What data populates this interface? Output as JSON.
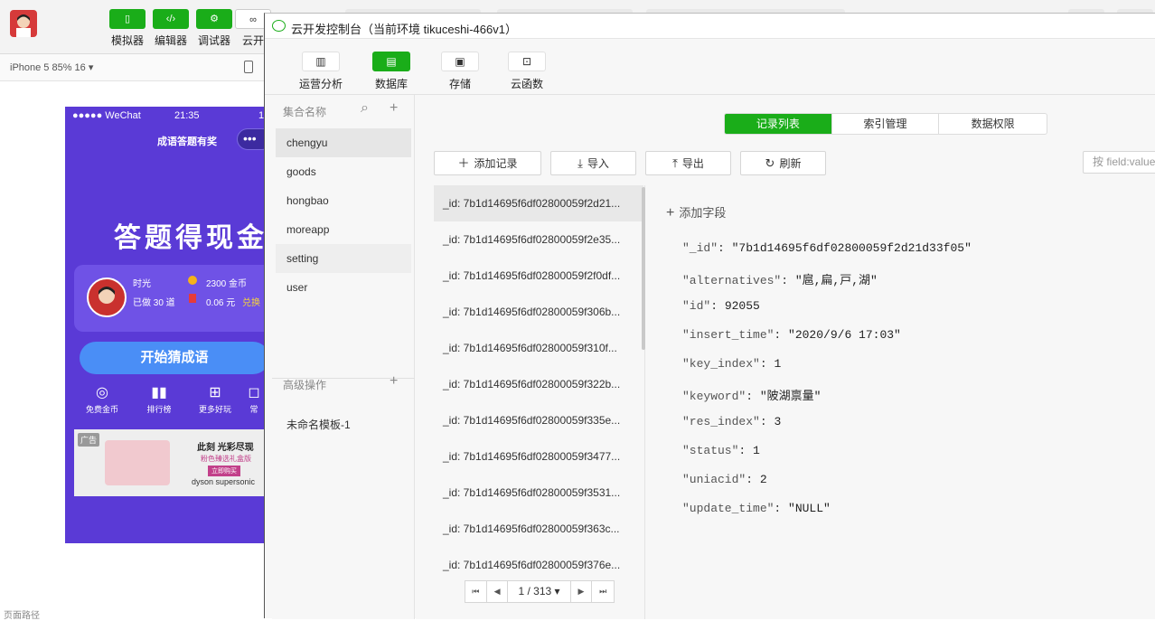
{
  "ide": {
    "tools": [
      {
        "label": "模拟器",
        "icon": "phone-icon",
        "glyph": "▯"
      },
      {
        "label": "编辑器",
        "icon": "code-icon",
        "glyph": "‹/›"
      },
      {
        "label": "调试器",
        "icon": "sliders-icon",
        "glyph": "⚙"
      },
      {
        "label": "云开",
        "icon": "cloud-icon",
        "glyph": "∞"
      }
    ]
  },
  "simulator": {
    "device": "iPhone 5 85% 16 ▾",
    "phone": {
      "carrier": "●●●●● WeChat",
      "time": "21:35",
      "battery": "1",
      "title": "成语答题有奖",
      "capsule": "•••",
      "hero": "答题得现金",
      "user_name": "时光",
      "done": "已做 30 道",
      "coins": "2300 金币",
      "cash": "0.06 元",
      "exchange": "兑换",
      "start_button": "开始猜成语",
      "icons": [
        "免费金币",
        "排行榜",
        "更多好玩",
        "常"
      ],
      "ad": {
        "tag": "广告",
        "line1": "此刻 光彩尽现",
        "line2": "粉色臻选礼盒版",
        "cta": "立即购买",
        "brand": "dyson supersonic"
      }
    },
    "footer": "页面路径"
  },
  "console": {
    "title": "云开发控制台（当前环境 tikuceshi-466v1）",
    "tabs": [
      {
        "label": "运营分析",
        "glyph": "▥",
        "active": false
      },
      {
        "label": "数据库",
        "glyph": "▤",
        "active": true
      },
      {
        "label": "存储",
        "glyph": "▣",
        "active": false
      },
      {
        "label": "云函数",
        "glyph": "⊡",
        "active": false
      }
    ],
    "collections_header": "集合名称",
    "collections": [
      "chengyu",
      "goods",
      "hongbao",
      "moreapp",
      "setting",
      "user"
    ],
    "advanced_header": "高级操作",
    "advanced_items": [
      "未命名模板-1"
    ],
    "segments": [
      "记录列表",
      "索引管理",
      "数据权限"
    ],
    "actions": {
      "add": "添加记录",
      "import": "导入",
      "export": "导出",
      "refresh": "刷新"
    },
    "filter_placeholder": "按 field:value",
    "records": [
      "_id: 7b1d14695f6df02800059f2d21...",
      "_id: 7b1d14695f6df02800059f2e35...",
      "_id: 7b1d14695f6df02800059f2f0df...",
      "_id: 7b1d14695f6df02800059f306b...",
      "_id: 7b1d14695f6df02800059f310f...",
      "_id: 7b1d14695f6df02800059f322b...",
      "_id: 7b1d14695f6df02800059f335e...",
      "_id: 7b1d14695f6df02800059f3477...",
      "_id: 7b1d14695f6df02800059f3531...",
      "_id: 7b1d14695f6df02800059f363c...",
      "_id: 7b1d14695f6df02800059f376e..."
    ],
    "pager": {
      "first": "⏮",
      "prev": "◀",
      "page": "1 / 313 ▾",
      "next": "▶",
      "last": "⏭"
    },
    "add_field": "添加字段",
    "document": [
      {
        "key": "\"_id\"",
        "value": "\"7b1d14695f6df02800059f2d21d33f05\""
      },
      {
        "key": "\"alternatives\"",
        "value": "\"扈,扁,戸,湖\""
      },
      {
        "key": "\"id\"",
        "value": "92055"
      },
      {
        "key": "\"insert_time\"",
        "value": "\"2020/9/6 17:03\""
      },
      {
        "key": "\"key_index\"",
        "value": "1"
      },
      {
        "key": "\"keyword\"",
        "value": "\"陂湖禀量\""
      },
      {
        "key": "\"res_index\"",
        "value": "3"
      },
      {
        "key": "\"status\"",
        "value": "1"
      },
      {
        "key": "\"uniacid\"",
        "value": "2"
      },
      {
        "key": "\"update_time\"",
        "value": "\"NULL\""
      }
    ]
  },
  "colors": {
    "accent": "#1aad19",
    "phone_bg": "#5a3ad6",
    "start_button": "#4a8ef6"
  }
}
